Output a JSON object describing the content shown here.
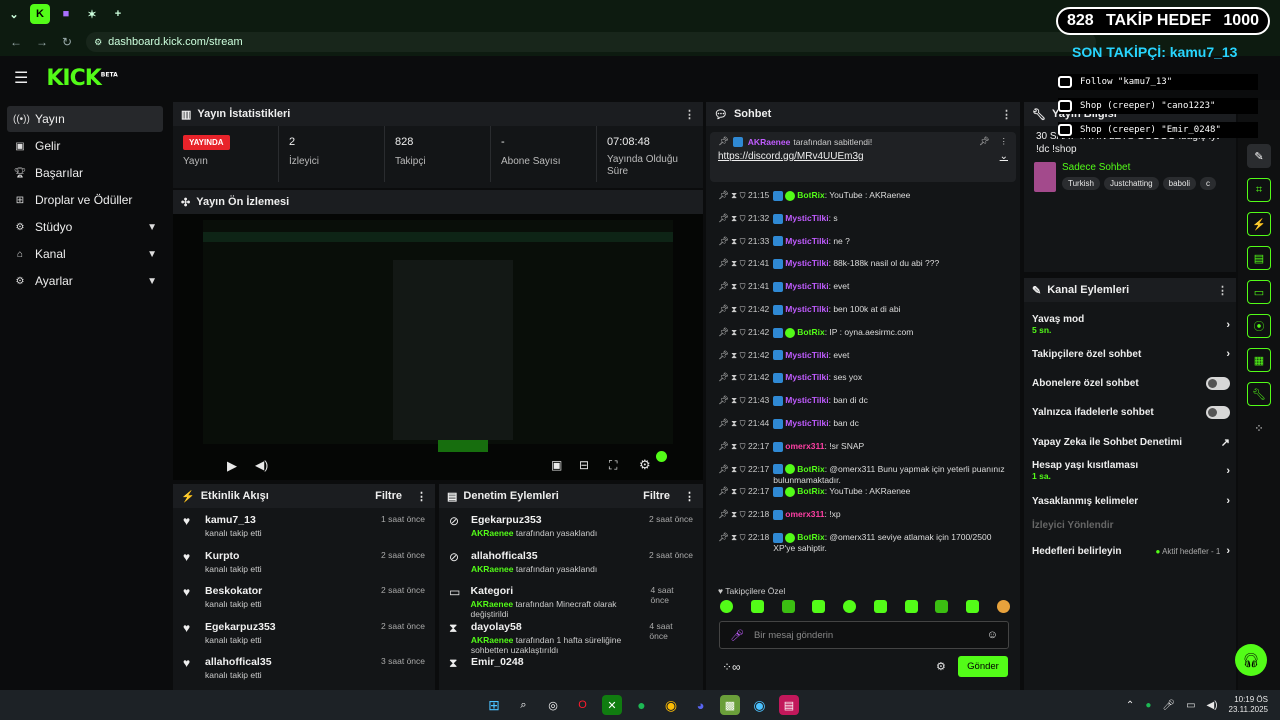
{
  "browser": {
    "url": "dashboard.kick.com/stream"
  },
  "site": {
    "logo": "KICK",
    "logo_sup": "BETA"
  },
  "sidebar": {
    "items": [
      {
        "label": "Yayın",
        "icon": "broadcast-icon"
      },
      {
        "label": "Gelir",
        "icon": "money-icon"
      },
      {
        "label": "Başarılar",
        "icon": "trophy-icon"
      },
      {
        "label": "Droplar ve Ödüller",
        "icon": "gift-icon"
      },
      {
        "label": "Stüdyo",
        "icon": "studio-icon"
      },
      {
        "label": "Kanal",
        "icon": "channel-icon"
      },
      {
        "label": "Ayarlar",
        "icon": "gear-icon"
      }
    ]
  },
  "stats": {
    "title": "Yayın İstatistikleri",
    "live_badge": "YAYINDA",
    "live_label": "Yayın",
    "viewers_value": "2",
    "viewers_label": "İzleyici",
    "followers_value": "828",
    "followers_label": "Takipçi",
    "subs_value": "-",
    "subs_label": "Abone Sayısı",
    "duration_value": "07:08:48",
    "duration_label_1": "Yayında Olduğu",
    "duration_label_2": "Süre"
  },
  "preview": {
    "title": "Yayın Ön İzlemesi"
  },
  "activity": {
    "title": "Etkinlik Akışı",
    "filter": "Filtre",
    "items": [
      {
        "name": "kamu7_13",
        "desc": "kanalı takip etti",
        "time": "1 saat önce"
      },
      {
        "name": "Kurpto",
        "desc": "kanalı takip etti",
        "time": "2 saat önce"
      },
      {
        "name": "Beskokator",
        "desc": "kanalı takip etti",
        "time": "2 saat önce"
      },
      {
        "name": "Egekarpuz353",
        "desc": "kanalı takip etti",
        "time": "2 saat önce"
      },
      {
        "name": "allahoffical35",
        "desc": "kanalı takip etti",
        "time": "3 saat önce"
      }
    ]
  },
  "moderation": {
    "title": "Denetim Eylemleri",
    "filter": "Filtre",
    "items": [
      {
        "name": "Egekarpuz353",
        "actor": "AKRaenee",
        "desc": "tarafından yasaklandı",
        "extra": "",
        "time": "2 saat önce",
        "icon": "ban-icon"
      },
      {
        "name": "allahoffical35",
        "actor": "AKRaenee",
        "desc": "tarafından yasaklandı",
        "extra": "",
        "time": "2 saat önce",
        "icon": "ban-icon"
      },
      {
        "name": "Kategori",
        "actor": "AKRaenee",
        "desc": "tarafından",
        "extra": "Minecraft olarak değiştirildi",
        "time": "4 saat önce",
        "icon": "category-icon"
      },
      {
        "name": "dayolay58",
        "actor": "AKRaenee",
        "desc": "tarafından 1 hafta süreliğine sohbetten uzaklaştırıldı",
        "extra": "",
        "time": "4 saat önce",
        "icon": "timeout-icon"
      },
      {
        "name": "Emir_0248",
        "actor": "",
        "desc": "",
        "extra": "",
        "time": "",
        "icon": "timeout-icon"
      }
    ]
  },
  "chat": {
    "title": "Sohbet",
    "pinned_by": "AKRaenee",
    "pinned_suffix": "tarafından sabitlendi!",
    "pinned_link": "https://discord.gg/MRv4UUEm3g",
    "messages": [
      {
        "time": "21:15",
        "user": "BotRix",
        "color": "#53fc18",
        "bot": true,
        "text": ": YouTube : AKRaenee"
      },
      {
        "time": "21:32",
        "user": "MysticTilki",
        "color": "#c05cff",
        "bot": false,
        "text": ": s"
      },
      {
        "time": "21:33",
        "user": "MysticTilki",
        "color": "#c05cff",
        "bot": false,
        "text": ": ne ?"
      },
      {
        "time": "21:41",
        "user": "MysticTilki",
        "color": "#c05cff",
        "bot": false,
        "text": ": 88k-188k nasil ol du abi ???"
      },
      {
        "time": "21:41",
        "user": "MysticTilki",
        "color": "#c05cff",
        "bot": false,
        "text": ": evet"
      },
      {
        "time": "21:42",
        "user": "MysticTilki",
        "color": "#c05cff",
        "bot": false,
        "text": ": ben 100k at di abi"
      },
      {
        "time": "21:42",
        "user": "BotRix",
        "color": "#53fc18",
        "bot": true,
        "text": ": IP : oyna.aesirmc.com"
      },
      {
        "time": "21:42",
        "user": "MysticTilki",
        "color": "#c05cff",
        "bot": false,
        "text": ": evet"
      },
      {
        "time": "21:42",
        "user": "MysticTilki",
        "color": "#c05cff",
        "bot": false,
        "text": ": ses yox"
      },
      {
        "time": "21:43",
        "user": "MysticTilki",
        "color": "#c05cff",
        "bot": false,
        "text": ": ban di dc"
      },
      {
        "time": "21:44",
        "user": "MysticTilki",
        "color": "#c05cff",
        "bot": false,
        "text": ": ban dc"
      },
      {
        "time": "22:17",
        "user": "omerx311",
        "color": "#ff3fa4",
        "bot": false,
        "text": ": !sr SNAP"
      },
      {
        "time": "22:17",
        "user": "BotRix",
        "color": "#53fc18",
        "bot": true,
        "text": ": @omerx311 Bunu yapmak için yeterli puanınız bulunmamaktadır."
      },
      {
        "time": "22:17",
        "user": "BotRix",
        "color": "#53fc18",
        "bot": true,
        "text": ": YouTube : AKRaenee"
      },
      {
        "time": "22:18",
        "user": "omerx311",
        "color": "#ff3fa4",
        "bot": false,
        "text": ": !xp"
      },
      {
        "time": "22:18",
        "user": "BotRix",
        "color": "#53fc18",
        "bot": true,
        "text": ": @omerx311 seviye atlamak için 1700/2500 XP'ye sahiptir."
      }
    ],
    "mode_label": "Takipçilere Özel",
    "input_placeholder": "Bir mesaj gönderin",
    "send_label": "Gönder"
  },
  "stream_info": {
    "title": "Yayın Bilgisi",
    "stream_title": "30 SAAT YAYIN LETS GOOOO !bağış !yt !dc !shop",
    "category": "Sadece Sohbet",
    "tags": [
      "Turkish",
      "Justchatting",
      "baboli",
      "c"
    ]
  },
  "channel_actions": {
    "title": "Kanal Eylemleri",
    "slow_mode": "Yavaş mod",
    "slow_mode_value": "5 sn.",
    "followers_only": "Takipçilere özel sohbet",
    "subs_only": "Abonelere özel sohbet",
    "emotes_only": "Yalnızca ifadelerle sohbet",
    "ai_moderation": "Yapay Zeka ile Sohbet Denetimi",
    "account_age": "Hesap yaşı kısıtlaması",
    "account_age_value": "1 sa.",
    "banned_words": "Yasaklanmış kelimeler",
    "raid": "İzleyici Yönlendir",
    "goals": "Hedefleri belirleyin",
    "goals_value": "Aktif hedefler - 1"
  },
  "overlay": {
    "goal_current": "828",
    "goal_label": "TAKİP HEDEF",
    "goal_target": "1000",
    "last_follower": "SON TAKİPÇİ: kamu7_13",
    "alerts": [
      "Follow \"kamu7_13\"",
      "Shop (creeper) \"cano1223\"",
      "Shop (creeper) \"Emir_0248\""
    ]
  },
  "taskbar": {
    "time": "10:19 ÖS",
    "date": "23.11.2025"
  },
  "colors": {
    "accent": "#53fc18",
    "live": "#e8232a",
    "bg": "#0b0c0d",
    "panel": "#131517"
  }
}
